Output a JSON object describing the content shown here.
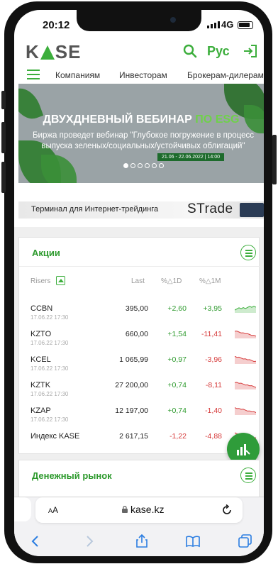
{
  "status": {
    "time": "20:12",
    "network": "4G"
  },
  "header": {
    "logo": [
      "K",
      "SE"
    ],
    "language": "Рус",
    "nav": [
      "Компаниям",
      "Инвесторам",
      "Брокерам-дилерам"
    ]
  },
  "banner": {
    "title": "ДВУХДНЕВНЫЙ ВЕБИНАР",
    "title_accent": "ПО ESG",
    "subtitle": "Биржа проведет вебинар \"Глубокое погружение в процесс выпуска зеленых/социальных/устойчивых облигаций\"",
    "date": "21.06 - 22.06.2022 | 14:00",
    "slides": 6,
    "active_slide": 0
  },
  "strip": {
    "text": "Терминал для Интернет-трейдинга",
    "logo": "STrade"
  },
  "stocks": {
    "title": "Акции",
    "columns": {
      "name": "Risers",
      "last": "Last",
      "d1": "%△1D",
      "m1": "%△1M"
    },
    "rows": [
      {
        "ticker": "CCBN",
        "date": "17.06.22 17:30",
        "last": "395,00",
        "d1": "+2,60",
        "m1": "+3,95",
        "trend": "up"
      },
      {
        "ticker": "KZTO",
        "date": "17.06.22 17:30",
        "last": "660,00",
        "d1": "+1,54",
        "m1": "-11,41",
        "trend": "down"
      },
      {
        "ticker": "KCEL",
        "date": "17.06.22 17:30",
        "last": "1 065,99",
        "d1": "+0,97",
        "m1": "-3,96",
        "trend": "down"
      },
      {
        "ticker": "KZTK",
        "date": "17.06.22 17:30",
        "last": "27 200,00",
        "d1": "+0,74",
        "m1": "-8,11",
        "trend": "down"
      },
      {
        "ticker": "KZAP",
        "date": "17.06.22 17:30",
        "last": "12 197,00",
        "d1": "+0,74",
        "m1": "-1,40",
        "trend": "down"
      },
      {
        "ticker": "Индекс KASE",
        "date": "",
        "last": "2 617,15",
        "d1": "-1,22",
        "m1": "-4,88",
        "trend": "down"
      }
    ]
  },
  "money_market": {
    "title": "Денежный рынок"
  },
  "browser": {
    "text_size": "AA",
    "url": "kase.kz"
  },
  "colors": {
    "brand_green": "#3cae3c",
    "negative": "#d63a3a"
  }
}
